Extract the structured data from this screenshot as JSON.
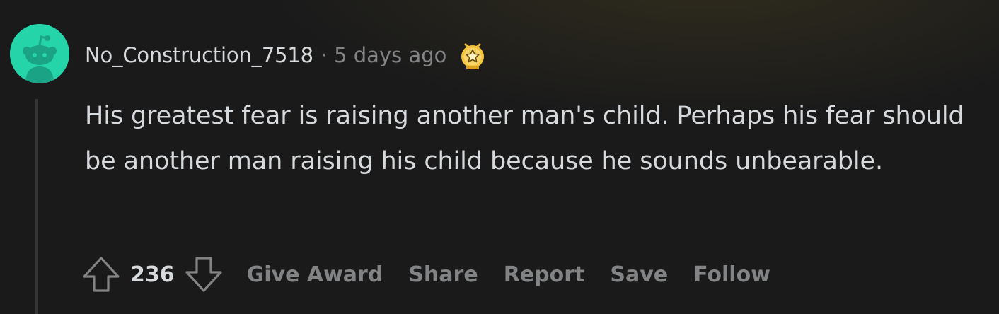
{
  "comment": {
    "username": "No_Construction_7518",
    "separator": "·",
    "timestamp": "5 days ago",
    "award_icon": "gold-star-award-icon",
    "avatar_icon": "snoo-avatar-icon",
    "body": "His greatest fear is raising another man's child. Perhaps his fear should be another man raising his child because he sounds unbearable.",
    "score": "236",
    "actions": {
      "give_award": "Give Award",
      "share": "Share",
      "report": "Report",
      "save": "Save",
      "follow": "Follow"
    }
  },
  "colors": {
    "background": "#1a1a1b",
    "text": "#d7dadc",
    "muted": "#818384",
    "avatar": "#25d4a8",
    "award_gold": "#f5c33b"
  }
}
